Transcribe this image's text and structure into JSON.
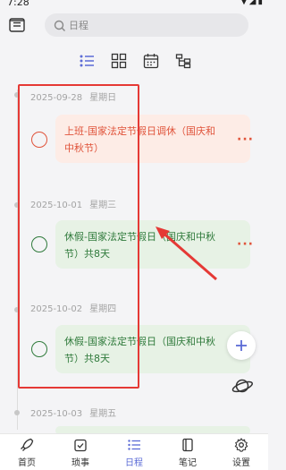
{
  "status": {
    "time": "7:28"
  },
  "search": {
    "placeholder": "日程"
  },
  "view_switch": {
    "items": [
      "list-view-icon",
      "grid-view-icon",
      "calendar-view-icon",
      "tree-view-icon"
    ]
  },
  "days": [
    {
      "date": "2025-09-28",
      "weekday": "星期日",
      "text": "上班-国家法定节假日调休（国庆和中秋节）",
      "style": "red"
    },
    {
      "date": "2025-10-01",
      "weekday": "星期三",
      "text": "休假-国家法定节假日（国庆和中秋节）共8天",
      "style": "green"
    },
    {
      "date": "2025-10-02",
      "weekday": "星期四",
      "text": "休假-国家法定节假日（国庆和中秋节）共8天",
      "style": "green"
    },
    {
      "date": "2025-10-03",
      "weekday": "星期五"
    }
  ],
  "card_text_lines": {
    "0": [
      "上班-国家法定节假日调休（国庆和",
      "中秋节）"
    ],
    "1": [
      "休假-国家法定节假日（国庆和中秋",
      "节）共8天"
    ],
    "2": [
      "休假-国家法定节假日（国庆和中秋",
      "节）共8天"
    ]
  },
  "more_label": "···",
  "nav": {
    "home": "首页",
    "tasks": "琐事",
    "schedule": "日程",
    "notes": "笔记",
    "settings": "设置"
  },
  "colors": {
    "accent": "#5b6bd6",
    "red_text": "#e0533a",
    "red_bg": "#fdece6",
    "green_text": "#2f7a3b",
    "green_bg": "#e7f2e5",
    "annotation": "#e53935"
  }
}
